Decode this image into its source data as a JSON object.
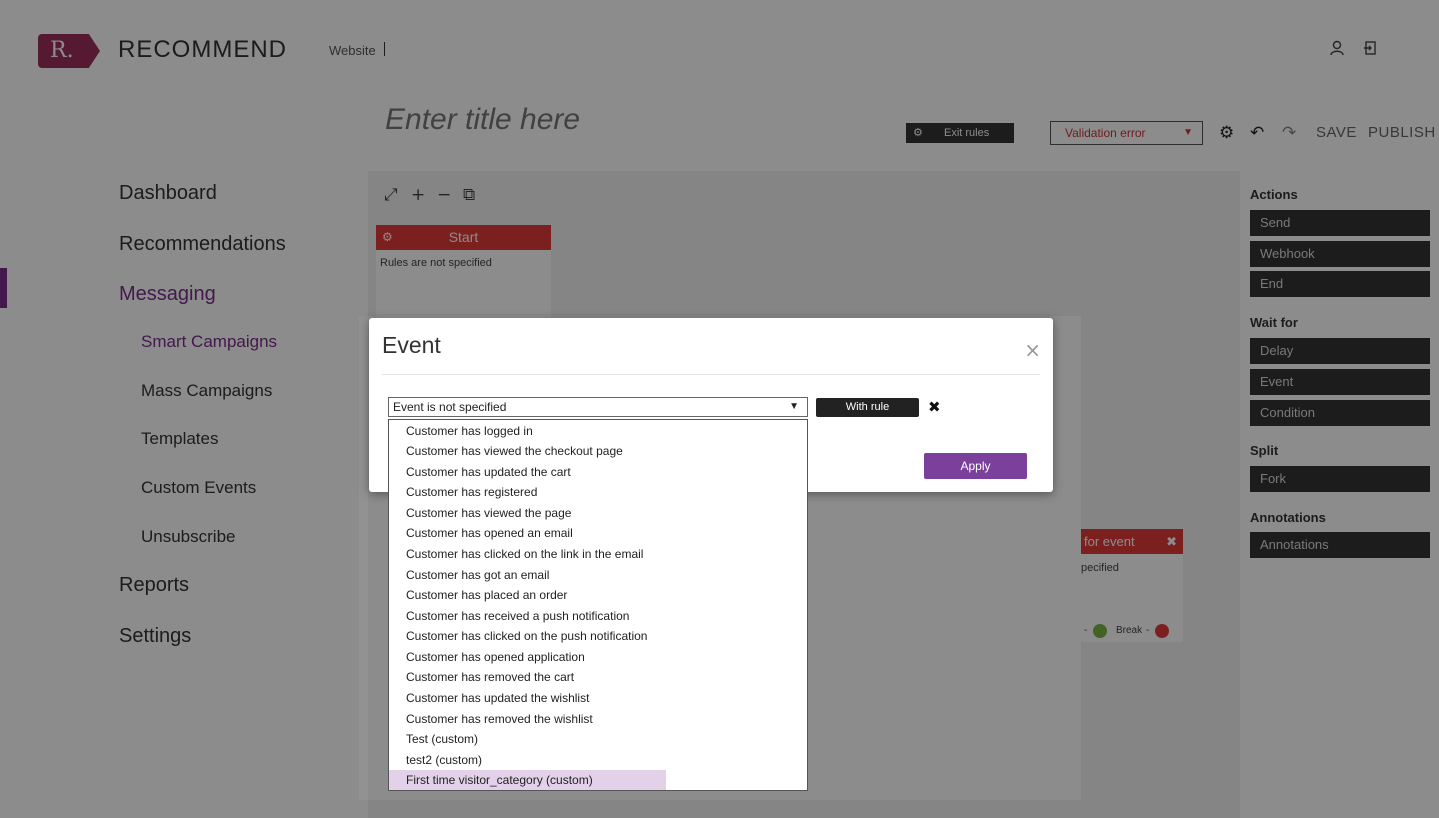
{
  "header": {
    "logo_mark": "R.",
    "logo_text": "RECOMMEND",
    "site_label": "Website",
    "user_icon": "user-icon",
    "logout_icon": "logout-icon"
  },
  "editor": {
    "title_placeholder": "Enter title here",
    "exit_rules_label": "Exit rules",
    "validation_status": "Validation error",
    "save_label": "SAVE",
    "publish_label": "PUBLISH"
  },
  "nav": {
    "dashboard": "Dashboard",
    "recommendations": "Recommendations",
    "messaging": "Messaging",
    "smart_campaigns": "Smart Campaigns",
    "mass_campaigns": "Mass Campaigns",
    "templates": "Templates",
    "custom_events": "Custom Events",
    "unsubscribe": "Unsubscribe",
    "reports": "Reports",
    "settings": "Settings"
  },
  "canvas": {
    "start_label": "Start",
    "start_rules": "Rules are not specified",
    "wait_label": "for event",
    "wait_spec": "pecified",
    "break_label": "Break"
  },
  "right_panel": {
    "actions_heading": "Actions",
    "send": "Send",
    "webhook": "Webhook",
    "end": "End",
    "wait_heading": "Wait for",
    "delay": "Delay",
    "event": "Event",
    "condition": "Condition",
    "split_heading": "Split",
    "fork": "Fork",
    "annotations_heading": "Annotations",
    "annotations": "Annotations"
  },
  "modal": {
    "title": "Event",
    "close": "×",
    "select_value": "Event is not specified",
    "with_rule_label": "With rule",
    "remove": "✖",
    "apply_label": "Apply"
  },
  "dropdown": {
    "options": [
      "Customer has logged in",
      "Customer has viewed the checkout page",
      "Customer has updated the cart",
      "Customer has registered",
      "Customer has viewed the page",
      "Customer has opened an email",
      "Customer has clicked on the link in the email",
      "Customer has got an email",
      "Customer has placed an order",
      "Customer has received a push notification",
      "Customer has clicked on the push notification",
      "Customer has opened application",
      "Customer has removed the cart",
      "Customer has updated the wishlist",
      "Customer has removed the wishlist",
      "Test (custom)",
      "test2 (custom)",
      "First time visitor_category (custom)"
    ],
    "highlighted_index": 17
  },
  "colors": {
    "brand": "#9b2f5a",
    "accent": "#7b2d8a",
    "node_red": "#e23a3a",
    "apply": "#7b3f9c",
    "highlight": "#e3d0e9"
  }
}
